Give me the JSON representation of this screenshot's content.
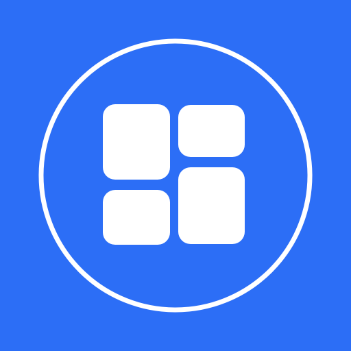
{
  "icon": {
    "name": "dashboard-grid-icon",
    "background_color": "#2C6EF6",
    "foreground_color": "#FFFFFF"
  }
}
